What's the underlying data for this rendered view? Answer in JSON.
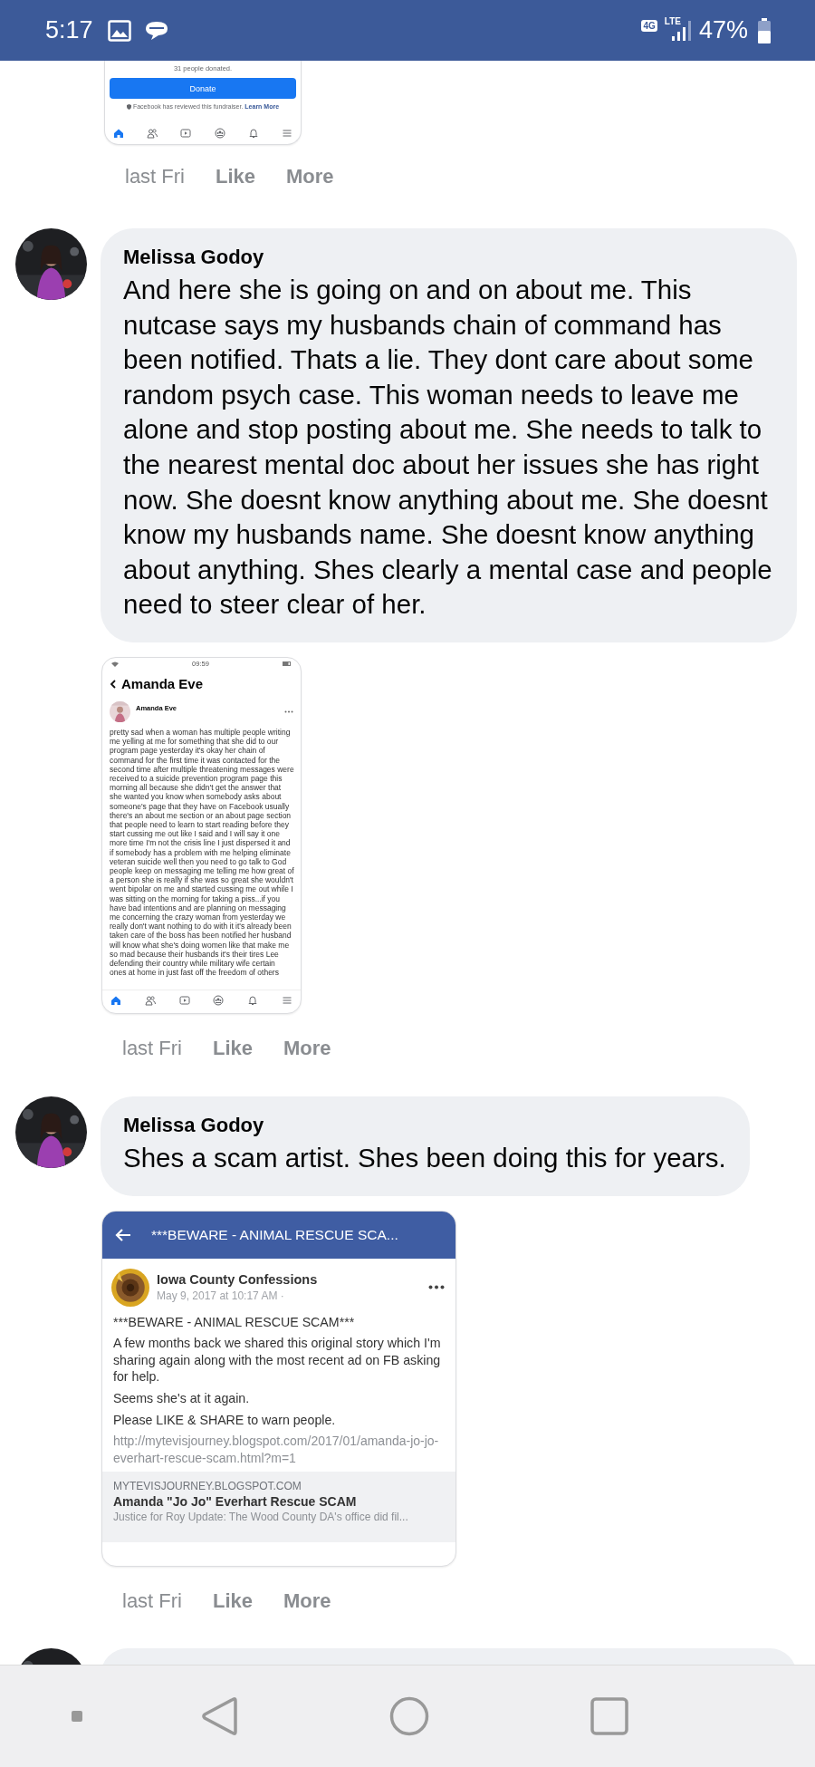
{
  "status_bar": {
    "time": "5:17",
    "net_badge": "4G",
    "net_type": "LTE",
    "battery": "47%"
  },
  "comments": [
    {
      "kind": "attachment_tail",
      "attachment": {
        "kind": "fundraiser",
        "donated_text": "31 people donated.",
        "button": "Donate",
        "note": "Facebook has reviewed this fundraiser.",
        "note_link": "Learn More"
      },
      "actions": {
        "time": "last Fri",
        "like": "Like",
        "more": "More"
      }
    },
    {
      "kind": "comment",
      "author": "Melissa Godoy",
      "text": "And here she is going on and on about me. This nutcase says my husbands chain of command has been notified. Thats a lie. They dont care about some random psych case. This woman needs to leave me alone and stop posting about me. She needs to talk to the nearest mental doc about her issues she has right now. She doesnt know anything about me. She doesnt know my husbands name. She doesnt know anything about anything. Shes clearly a mental case and people need to steer clear of her.",
      "attachment": {
        "kind": "profile_post",
        "status_time": "09:59",
        "page_title": "Amanda Eve",
        "post_author": "Amanda Eve",
        "post_lines": [
          "pretty sad when a woman has multiple people writing",
          "me yelling at me for something that she did to our",
          "program page yesterday it's okay her chain of",
          "command for the first time it was contacted for the",
          "second time after multiple threatening messages were",
          "received to a suicide prevention program page this",
          "morning all because she didn't get the answer that",
          "she wanted you know when somebody asks about",
          "someone's page that they have on Facebook usually",
          "there's an about me section or an about page section",
          "that people need to learn to start reading before they",
          "start cussing me out like I said and I will say it one",
          "more time I'm not the crisis line I just dispersed it and",
          "if somebody has a problem with me helping eliminate",
          "veteran suicide well then you need to go talk to God",
          "people keep on messaging me telling me how great of",
          "a person she is really if she was so great she wouldn't",
          "went bipolar on me and started cussing me out while I",
          "was sitting on the morning for taking a piss...if you",
          "have bad intentions and are planning on messaging",
          "me concerning the crazy woman from yesterday we",
          "really don't want nothing to do with it it's already been",
          "taken care of the boss has been notified her husband",
          "will know what she's doing women like that make me",
          "so mad because their husbands it's their tires Lee",
          "defending their country while military wife certain",
          "ones at home in just fast off the freedom of others"
        ]
      },
      "actions": {
        "time": "last Fri",
        "like": "Like",
        "more": "More"
      }
    },
    {
      "kind": "comment",
      "author": "Melissa Godoy",
      "text": "Shes a scam artist. Shes been doing this for years.",
      "attachment": {
        "kind": "shared_post",
        "header_title": "***BEWARE - ANIMAL RESCUE SCA...",
        "page_name": "Iowa County Confessions",
        "date": "May 9, 2017 at 10:17 AM ·",
        "paragraphs": [
          "***BEWARE - ANIMAL RESCUE SCAM***",
          "A few months back we shared this original story which I'm sharing again along with the most recent ad on FB asking for help.",
          "Seems she's at it again.",
          "Please LIKE & SHARE to warn people."
        ],
        "url": "http://mytevisjourney.blogspot.com/2017/01/amanda-jo-jo-everhart-rescue-scam.html?m=1",
        "preview": {
          "domain": "MYTEVISJOURNEY.BLOGSPOT.COM",
          "title": "Amanda \"Jo Jo\" Everhart Rescue SCAM",
          "description": "Justice for Roy Update: The Wood County DA's office did fil..."
        }
      },
      "actions": {
        "time": "last Fri",
        "like": "Like",
        "more": "More"
      }
    },
    {
      "kind": "partial"
    }
  ]
}
